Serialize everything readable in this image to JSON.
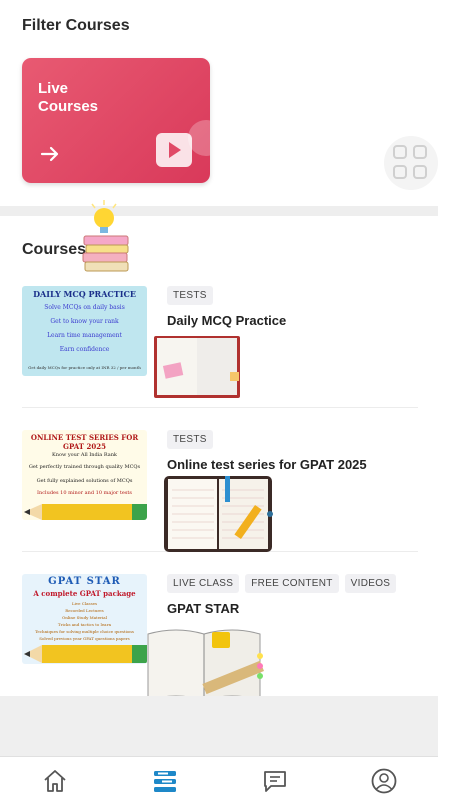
{
  "filter": {
    "title": "Filter Courses",
    "live_label": "Live Courses"
  },
  "courses_title": "Courses",
  "courses": [
    {
      "tags": [
        "TESTS"
      ],
      "title": "Daily MCQ Practice",
      "thumb": {
        "heading": "DAILY MCQ PRACTICE",
        "lines": [
          "Solve MCQs on daily basis",
          "Get to know your rank",
          "Learn time management",
          "Earn confidence"
        ],
        "footer": "Get daily MCQs for practice only at INR 32 / per month"
      }
    },
    {
      "tags": [
        "TESTS"
      ],
      "title": "Online test series for GPAT 2025",
      "thumb": {
        "heading": "ONLINE TEST SERIES FOR GPAT 2025",
        "lines": [
          "Know your All India Rank",
          "Get perfectly trained through quality MCQs",
          "Get fully explained solutions of MCQs",
          "Includes 10 minor and 10 major tests"
        ]
      }
    },
    {
      "tags": [
        "LIVE CLASS",
        "FREE CONTENT",
        "VIDEOS"
      ],
      "title": "GPAT STAR",
      "thumb": {
        "heading": "GPAT STAR",
        "subheading": "A complete GPAT package",
        "lines": [
          "Live Classes",
          "Recorded Lectures",
          "Online Study Material",
          "Tricks and tactics to learn",
          "Techniques for solving multiple choice questions",
          "Solved previous year GPAT questions papers"
        ]
      }
    }
  ],
  "colors": {
    "live_card": "#d9395a",
    "active_nav": "#1e88c8",
    "tag_bg": "#f0f0f3"
  },
  "nav": [
    {
      "icon": "home-icon",
      "label": ""
    },
    {
      "icon": "courses-icon",
      "label": ""
    },
    {
      "icon": "chat-icon",
      "label": ""
    },
    {
      "icon": "profile-icon",
      "label": ""
    }
  ]
}
